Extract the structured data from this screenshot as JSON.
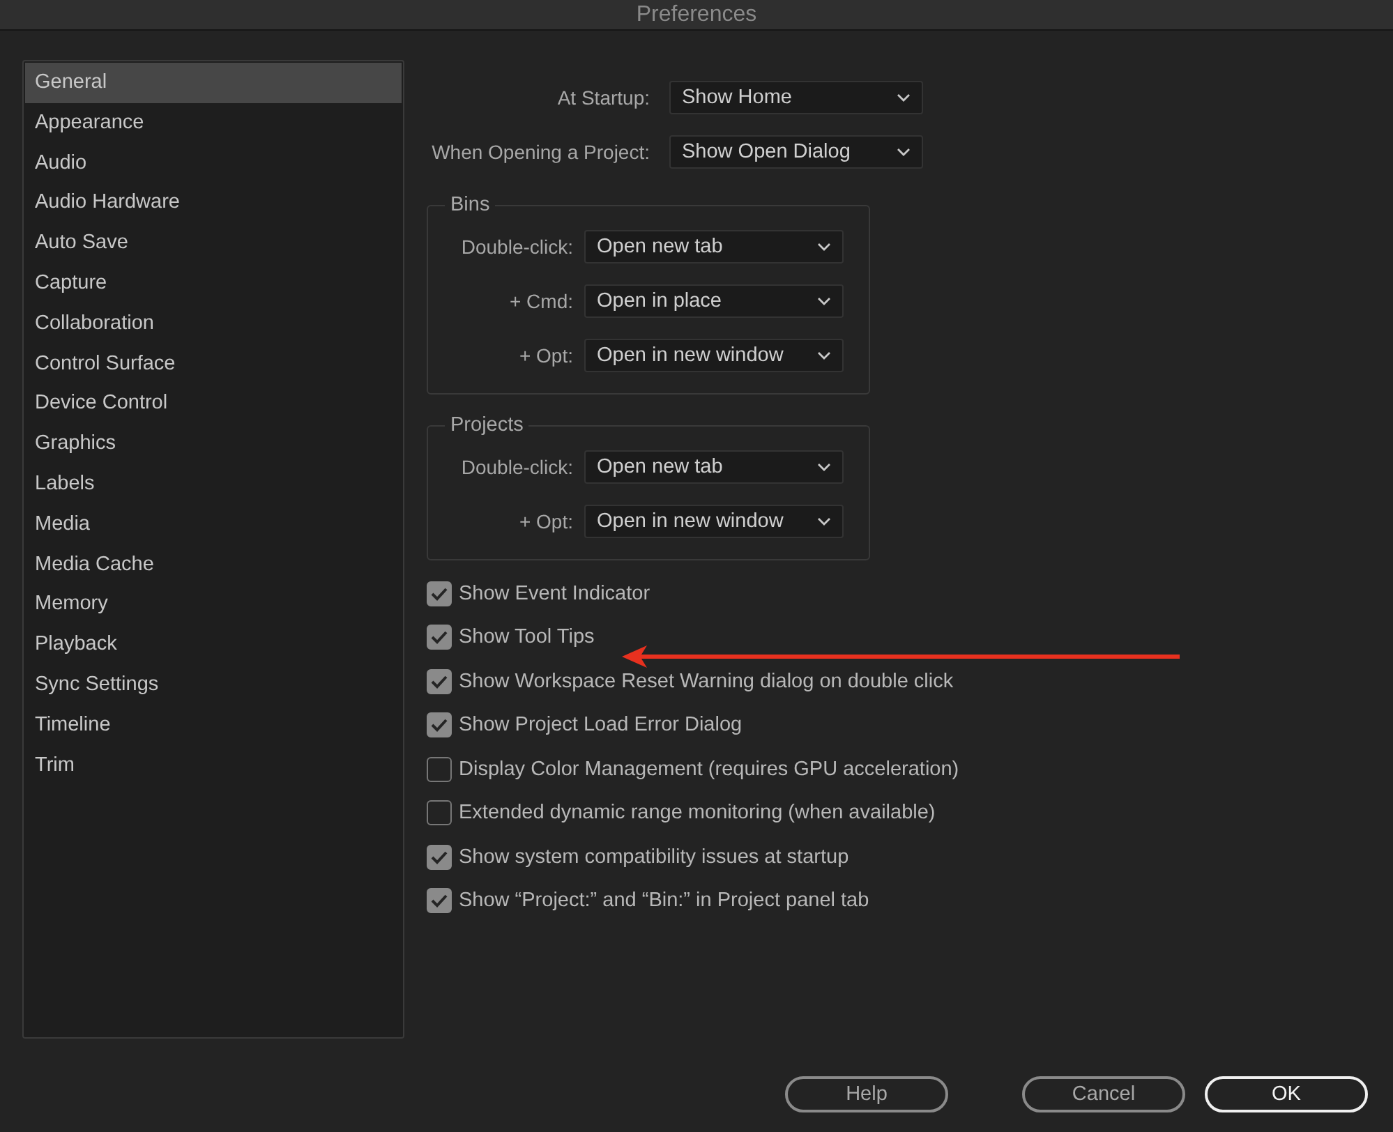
{
  "window": {
    "title": "Preferences"
  },
  "sidebar": {
    "items": [
      {
        "label": "General",
        "selected": true
      },
      {
        "label": "Appearance",
        "selected": false
      },
      {
        "label": "Audio",
        "selected": false
      },
      {
        "label": "Audio Hardware",
        "selected": false
      },
      {
        "label": "Auto Save",
        "selected": false
      },
      {
        "label": "Capture",
        "selected": false
      },
      {
        "label": "Collaboration",
        "selected": false
      },
      {
        "label": "Control Surface",
        "selected": false
      },
      {
        "label": "Device Control",
        "selected": false
      },
      {
        "label": "Graphics",
        "selected": false
      },
      {
        "label": "Labels",
        "selected": false
      },
      {
        "label": "Media",
        "selected": false
      },
      {
        "label": "Media Cache",
        "selected": false
      },
      {
        "label": "Memory",
        "selected": false
      },
      {
        "label": "Playback",
        "selected": false
      },
      {
        "label": "Sync Settings",
        "selected": false
      },
      {
        "label": "Timeline",
        "selected": false
      },
      {
        "label": "Trim",
        "selected": false
      }
    ]
  },
  "settings": [
    {
      "label": "At Startup:",
      "value": "Show Home"
    },
    {
      "label": "When Opening a Project:",
      "value": "Show Open Dialog"
    }
  ],
  "groups": [
    {
      "title": "Bins",
      "rows": [
        {
          "label": "Double-click:",
          "value": "Open new tab"
        },
        {
          "label": "+ Cmd:",
          "value": "Open in place"
        },
        {
          "label": "+ Opt:",
          "value": "Open in new window"
        }
      ]
    },
    {
      "title": "Projects",
      "rows": [
        {
          "label": "Double-click:",
          "value": "Open new tab"
        },
        {
          "label": "+ Opt:",
          "value": "Open in new window"
        }
      ]
    }
  ],
  "checkboxes": [
    {
      "label": "Show Event Indicator",
      "checked": true
    },
    {
      "label": "Show Tool Tips",
      "checked": true
    },
    {
      "label": "Show Workspace Reset Warning dialog on double click",
      "checked": true
    },
    {
      "label": "Show Project Load Error Dialog",
      "checked": true
    },
    {
      "label": "Display Color Management (requires GPU acceleration)",
      "checked": false
    },
    {
      "label": "Extended dynamic range monitoring (when available)",
      "checked": false
    },
    {
      "label": "Show system compatibility issues at startup",
      "checked": true
    },
    {
      "label": "Show “Project:” and “Bin:” in Project panel tab",
      "checked": true
    }
  ],
  "buttons": [
    {
      "label": "Help",
      "kind": "normal"
    },
    {
      "label": "Cancel",
      "kind": "normal"
    },
    {
      "label": "OK",
      "kind": "default"
    }
  ]
}
